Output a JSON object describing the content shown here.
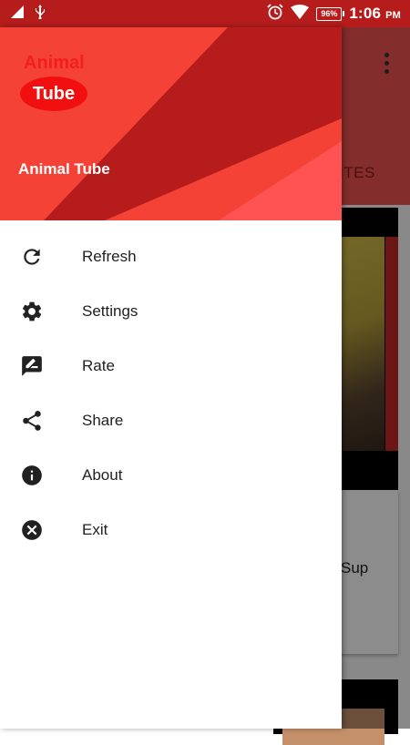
{
  "status_bar": {
    "time": "1:06",
    "ampm": "PM",
    "battery": "96%"
  },
  "background_app": {
    "tab_fragment": "ITES",
    "card_text_fragment": "Sup"
  },
  "drawer": {
    "logo_text_top": "Animal",
    "logo_text_pill": "Tube",
    "header_title": "Animal Tube",
    "items": [
      {
        "label": "Refresh",
        "icon": "refresh-icon"
      },
      {
        "label": "Settings",
        "icon": "gear-icon"
      },
      {
        "label": "Rate",
        "icon": "rate-icon"
      },
      {
        "label": "Share",
        "icon": "share-icon"
      },
      {
        "label": "About",
        "icon": "info-icon"
      },
      {
        "label": "Exit",
        "icon": "close-icon"
      }
    ]
  },
  "colors": {
    "status_bar": "#b71c1c",
    "header_primary": "#f44336",
    "header_dark": "#b71c1c",
    "logo_red": "#f20f0f"
  }
}
